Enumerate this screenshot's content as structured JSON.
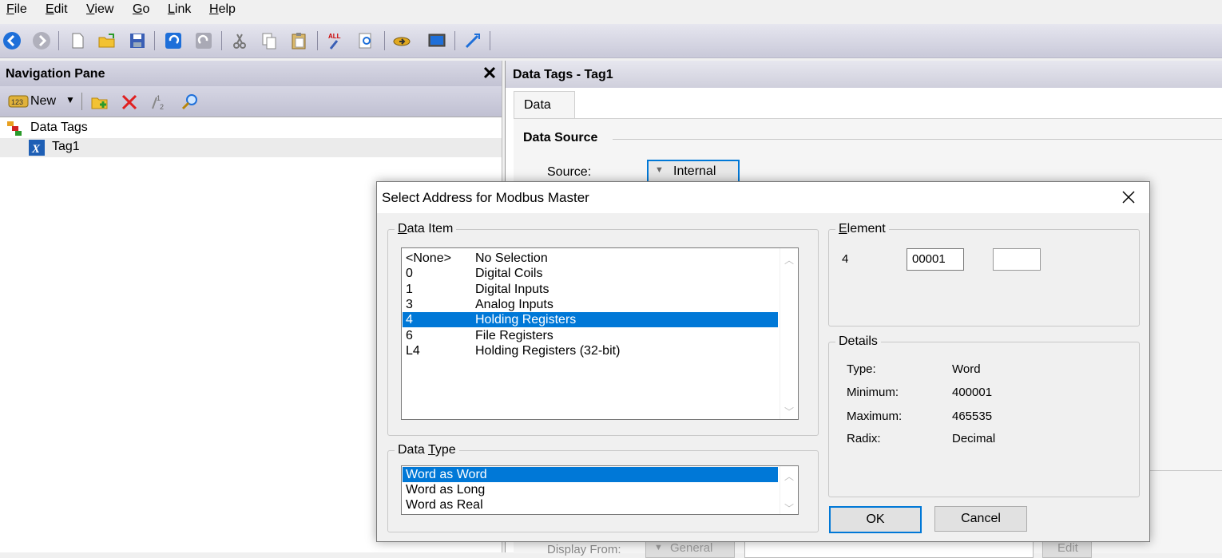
{
  "menu": {
    "items": [
      {
        "underline": "F",
        "rest": "ile"
      },
      {
        "underline": "E",
        "rest": "dit"
      },
      {
        "underline": "V",
        "rest": "iew"
      },
      {
        "underline": "G",
        "rest": "o"
      },
      {
        "underline": "L",
        "rest": "ink"
      },
      {
        "underline": "H",
        "rest": "elp"
      }
    ]
  },
  "nav": {
    "title": "Navigation Pane",
    "new_label": "New",
    "tree": {
      "root_label": "Data Tags",
      "child_label": "Tag1"
    }
  },
  "editor": {
    "title": "Data Tags - Tag1",
    "tab_label": "Data",
    "section_label": "Data Source",
    "source_label": "Source:",
    "source_value": "Internal",
    "display_from_label": "Display From:",
    "display_from_value": "General",
    "edit_label": "Edit"
  },
  "dialog": {
    "title": "Select Address for Modbus Master",
    "data_item": {
      "legend_ul": "D",
      "legend_rest": "ata Item",
      "rows": [
        {
          "code": "<None>",
          "name": "No Selection"
        },
        {
          "code": "0",
          "name": "Digital Coils"
        },
        {
          "code": "1",
          "name": "Digital Inputs"
        },
        {
          "code": "3",
          "name": "Analog Inputs"
        },
        {
          "code": "4",
          "name": "Holding Registers"
        },
        {
          "code": "6",
          "name": "File Registers"
        },
        {
          "code": "L4",
          "name": "Holding Registers (32-bit)"
        }
      ],
      "selected_index": 4
    },
    "data_type": {
      "legend_pre": "Data ",
      "legend_ul": "T",
      "legend_rest": "ype",
      "rows": [
        "Word as Word",
        "Word as Long",
        "Word as Real"
      ],
      "selected_index": 0
    },
    "element": {
      "legend_ul": "E",
      "legend_rest": "lement",
      "prefix": "4",
      "value": "00001",
      "extra_value": ""
    },
    "details": {
      "legend": "Details",
      "type_label": "Type:",
      "type_value": "Word",
      "min_label": "Minimum:",
      "min_value": "400001",
      "max_label": "Maximum:",
      "max_value": "465535",
      "radix_label": "Radix:",
      "radix_value": "Decimal"
    },
    "ok_label": "OK",
    "cancel_label": "Cancel"
  },
  "colors": {
    "selection": "#0078d7",
    "toolbar_blue": "#1e6fd9"
  }
}
